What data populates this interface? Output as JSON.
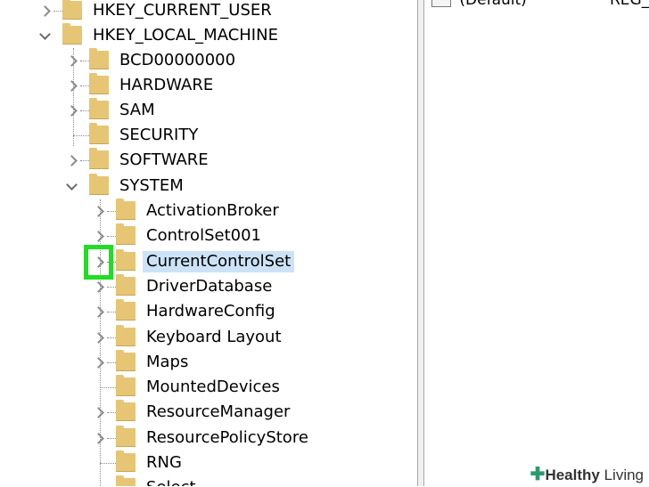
{
  "tree": {
    "nodes": [
      {
        "label": "HKEY_CURRENT_USER",
        "expander": "collapsed"
      },
      {
        "label": "HKEY_LOCAL_MACHINE",
        "expander": "expanded"
      },
      {
        "label": "BCD00000000",
        "expander": "collapsed"
      },
      {
        "label": "HARDWARE",
        "expander": "collapsed"
      },
      {
        "label": "SAM",
        "expander": "collapsed"
      },
      {
        "label": "SECURITY",
        "expander": "none"
      },
      {
        "label": "SOFTWARE",
        "expander": "collapsed"
      },
      {
        "label": "SYSTEM",
        "expander": "expanded"
      },
      {
        "label": "ActivationBroker",
        "expander": "collapsed"
      },
      {
        "label": "ControlSet001",
        "expander": "collapsed"
      },
      {
        "label": "CurrentControlSet",
        "expander": "collapsed",
        "selected": true
      },
      {
        "label": "DriverDatabase",
        "expander": "collapsed"
      },
      {
        "label": "HardwareConfig",
        "expander": "collapsed"
      },
      {
        "label": "Keyboard Layout",
        "expander": "collapsed"
      },
      {
        "label": "Maps",
        "expander": "collapsed"
      },
      {
        "label": "MountedDevices",
        "expander": "none"
      },
      {
        "label": "ResourceManager",
        "expander": "collapsed"
      },
      {
        "label": "ResourcePolicyStore",
        "expander": "collapsed"
      },
      {
        "label": "RNG",
        "expander": "none"
      },
      {
        "label": "Select",
        "expander": "none"
      }
    ]
  },
  "value_list": {
    "name": "(Default)",
    "type": "REG_SZ"
  },
  "watermark": {
    "bold_text": "Healthy",
    "text": " Living"
  },
  "colors": {
    "highlight_box": "#22dd22",
    "selection": "#cce3f7",
    "folder": "#e6c574"
  }
}
